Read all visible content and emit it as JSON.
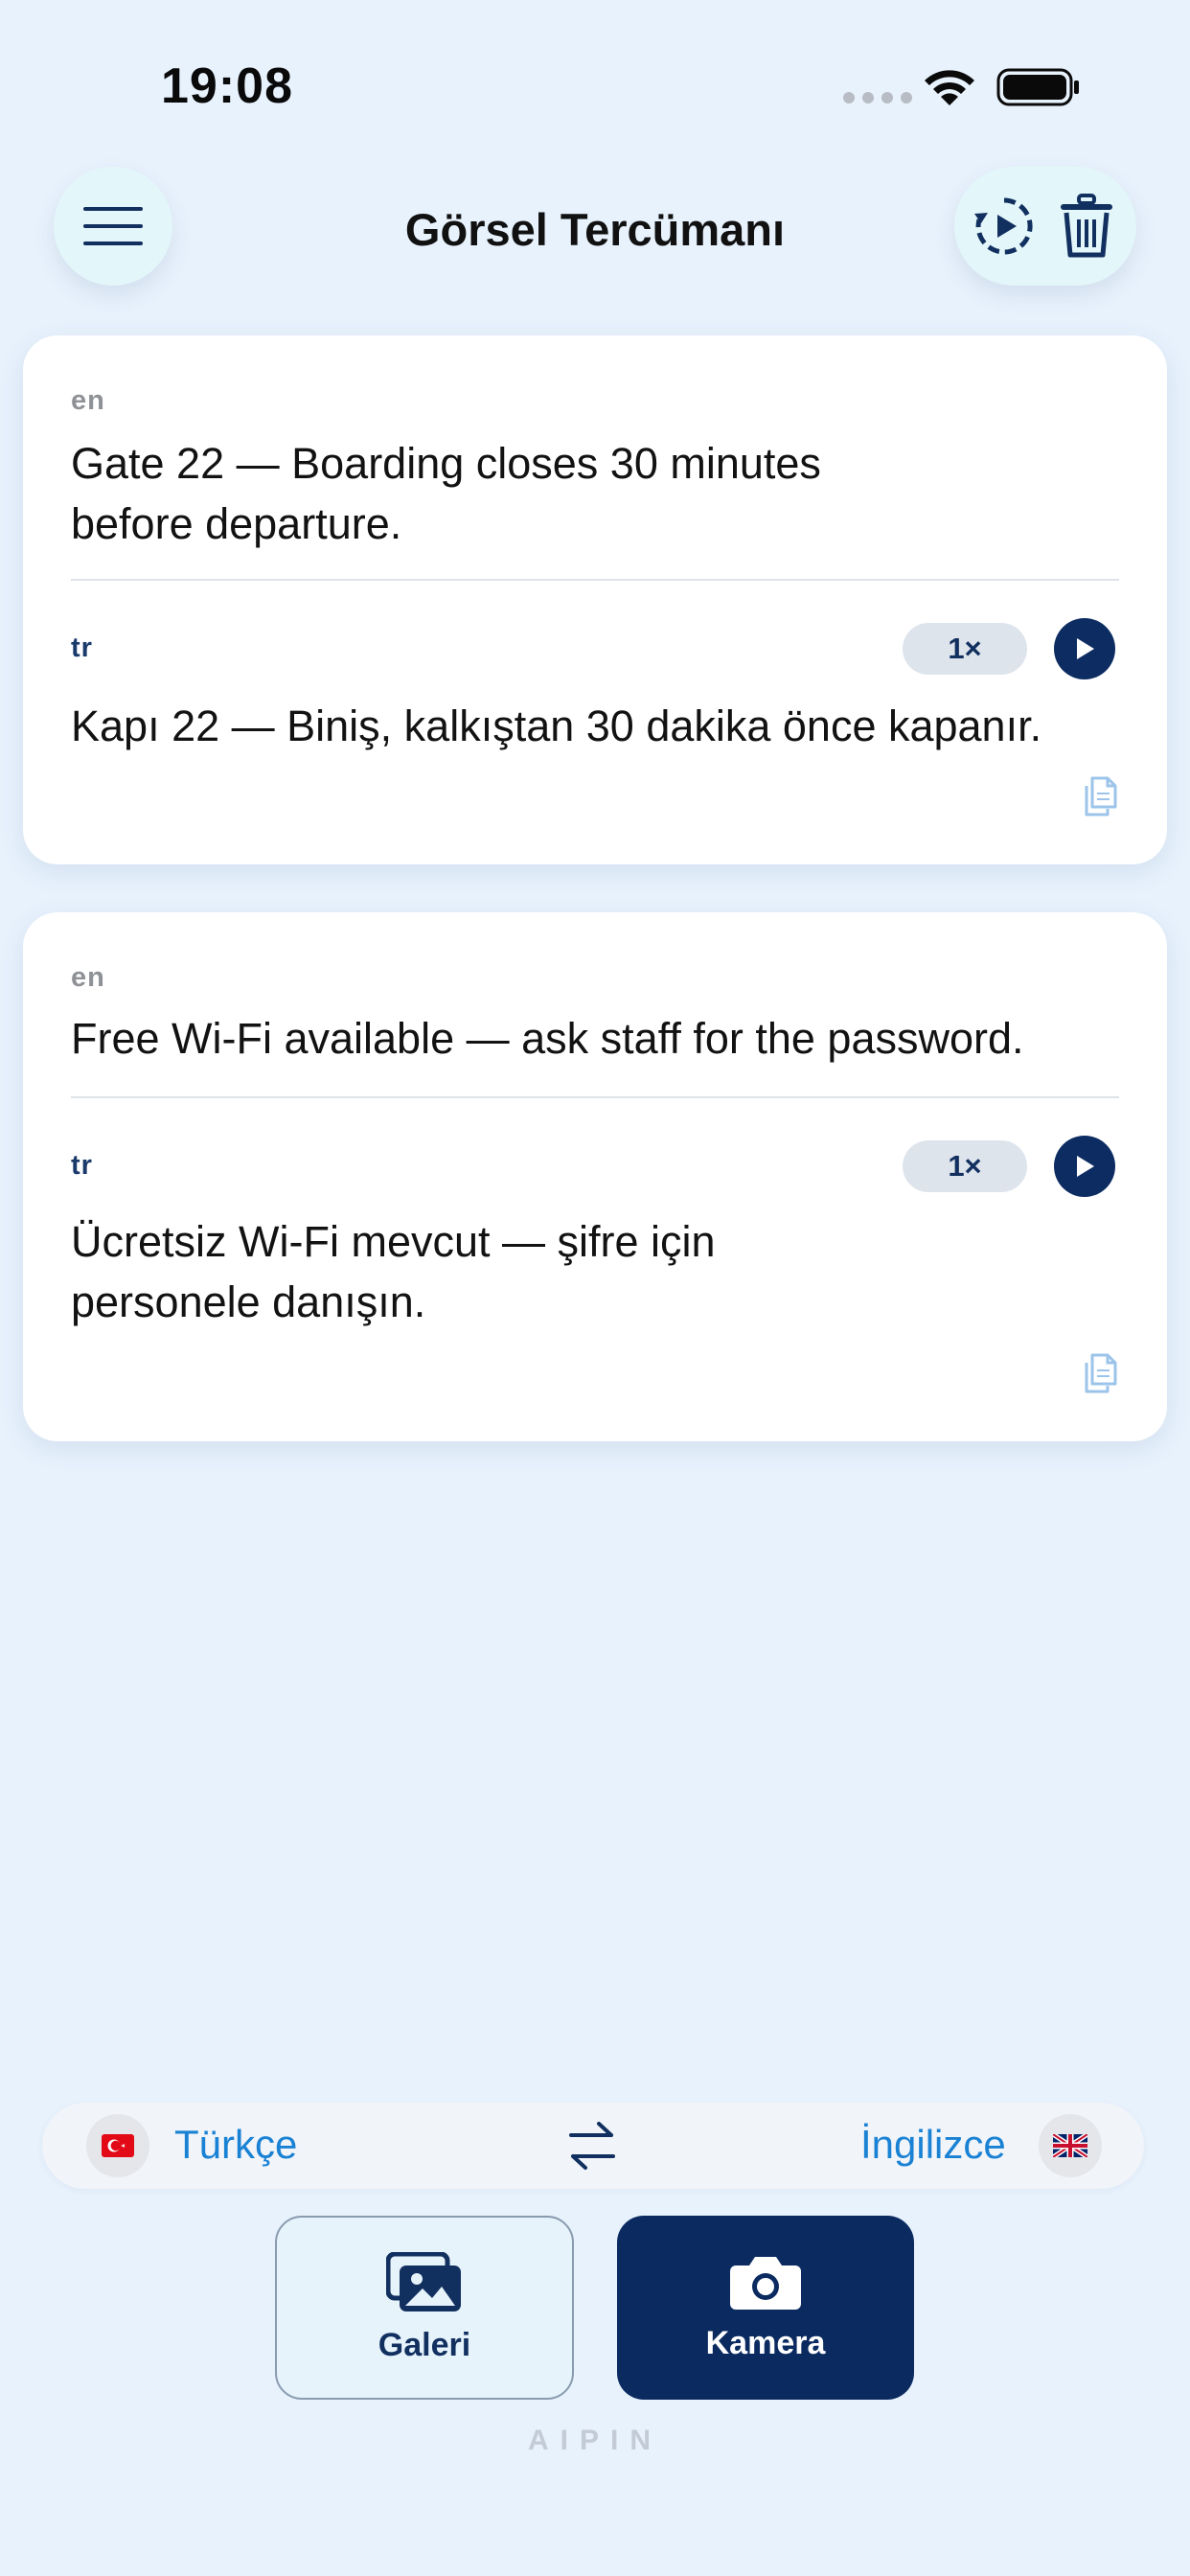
{
  "status_bar": {
    "time": "19:08"
  },
  "header": {
    "title": "Görsel Tercümanı"
  },
  "cards": [
    {
      "source_lang": "en",
      "source_text": "Gate 22 — Boarding closes 30 minutes before departure.",
      "target_lang": "tr",
      "speed": "1×",
      "target_text": "Kapı 22 — Biniş, kalkıştan 30 dakika önce kapanır."
    },
    {
      "source_lang": "en",
      "source_text": "Free Wi-Fi available — ask staff for the password.",
      "target_lang": "tr",
      "speed": "1×",
      "target_text": "Ücretsiz Wi-Fi mevcut — şifre için personele danışın."
    }
  ],
  "language_bar": {
    "source_language": "Türkçe",
    "target_language": "İngilizce",
    "source_flag": "turkey-flag-icon",
    "target_flag": "uk-flag-icon"
  },
  "actions": {
    "gallery_label": "Galeri",
    "camera_label": "Kamera"
  },
  "brand": "AIPIN",
  "colors": {
    "accent": "#0b2b60",
    "link": "#1a82d4",
    "background": "#e8f2fd"
  }
}
